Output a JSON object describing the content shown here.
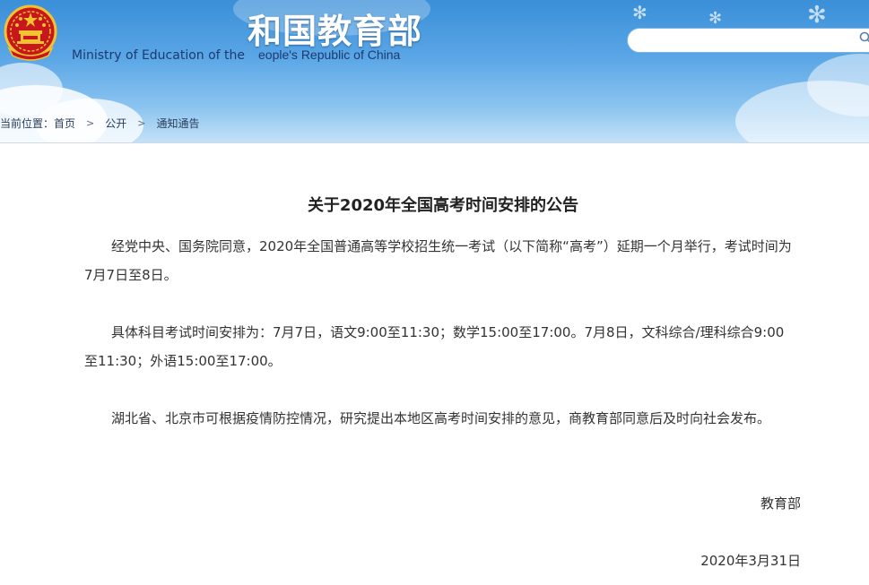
{
  "header": {
    "title_cn": "和国教育部",
    "title_en_left": "Ministry of Education of the",
    "title_en": "eople's Republic of China",
    "search_placeholder": ""
  },
  "breadcrumb": {
    "prefix": "当前位置：",
    "items": [
      "首页",
      "公开",
      "通知通告"
    ]
  },
  "article": {
    "title": "关于2020年全国高考时间安排的公告",
    "paragraphs": [
      "经党中央、国务院同意，2020年全国普通高等学校招生统一考试（以下简称“高考”）延期一个月举行，考试时间为7月7日至8日。",
      "具体科目考试时间安排为：7月7日，语文9:00至11:30；数学15:00至17:00。7月8日，文科综合/理科综合9:00至11:30；外语15:00至17:00。",
      "湖北省、北京市可根据疫情防控情况，研究提出本地区高考时间安排的意见，商教育部同意后及时向社会发布。"
    ],
    "signer": "教育部",
    "date": "2020年3月31日"
  },
  "colors": {
    "banner_top": "#3a8fd8",
    "banner_bottom": "#c4e2f8",
    "emblem_red": "#c8161d",
    "emblem_gold": "#f2c230"
  },
  "icons": {
    "emblem": "national-emblem-icon",
    "search": "search-icon",
    "breadcrumb_separator": "chevron-right-icon"
  }
}
